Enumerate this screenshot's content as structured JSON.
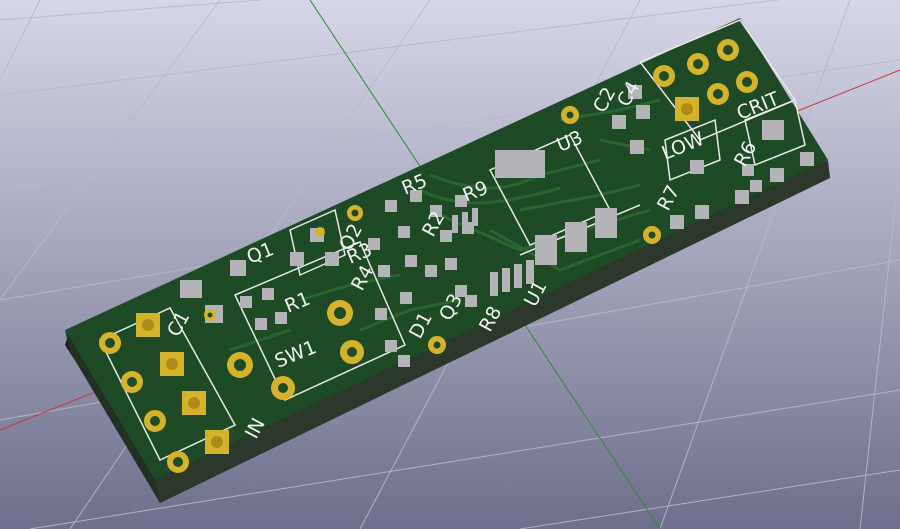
{
  "viewer": {
    "background_top": "#d6d6e8",
    "background_bottom": "#6e6f8c",
    "grid_color": "#b7b8cc",
    "x_axis_color": "#c23a3a",
    "y_axis_color": "#2f8a3a"
  },
  "board": {
    "solder_mask_color": "#1f4a26",
    "copper_color": "#d4b32a",
    "pad_color": "#b4b4b8",
    "silkscreen_color": "#f2f2f2",
    "references": {
      "c1": "C1",
      "sw1": "SW1",
      "in_label": "IN",
      "q1": "Q1",
      "r1": "R1",
      "q2": "Q2",
      "r5": "R5",
      "r3": "R3",
      "r4": "R4",
      "r2": "R2",
      "r9": "R9",
      "d1": "D1",
      "q3": "Q3",
      "r8": "R8",
      "u1": "U1",
      "u3": "U3",
      "c2": "C2",
      "c4": "C4",
      "low": "LOW",
      "r6": "R6",
      "r7": "R7",
      "crit": "CRIT"
    }
  }
}
